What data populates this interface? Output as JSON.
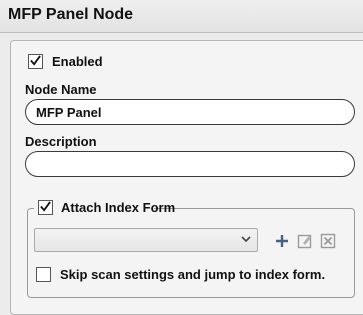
{
  "window": {
    "title": "MFP Panel Node"
  },
  "enabled": {
    "label": "Enabled",
    "checked": true
  },
  "node_name": {
    "label": "Node Name",
    "value": "MFP Panel"
  },
  "description": {
    "label": "Description",
    "value": ""
  },
  "attach_index_form": {
    "label": "Attach Index Form",
    "checked": true,
    "select_value": "",
    "icons": [
      "plus-icon",
      "edit-form-icon",
      "remove-icon"
    ]
  },
  "skip_scan": {
    "label": "Skip scan settings and jump to index form.",
    "checked": false
  }
}
